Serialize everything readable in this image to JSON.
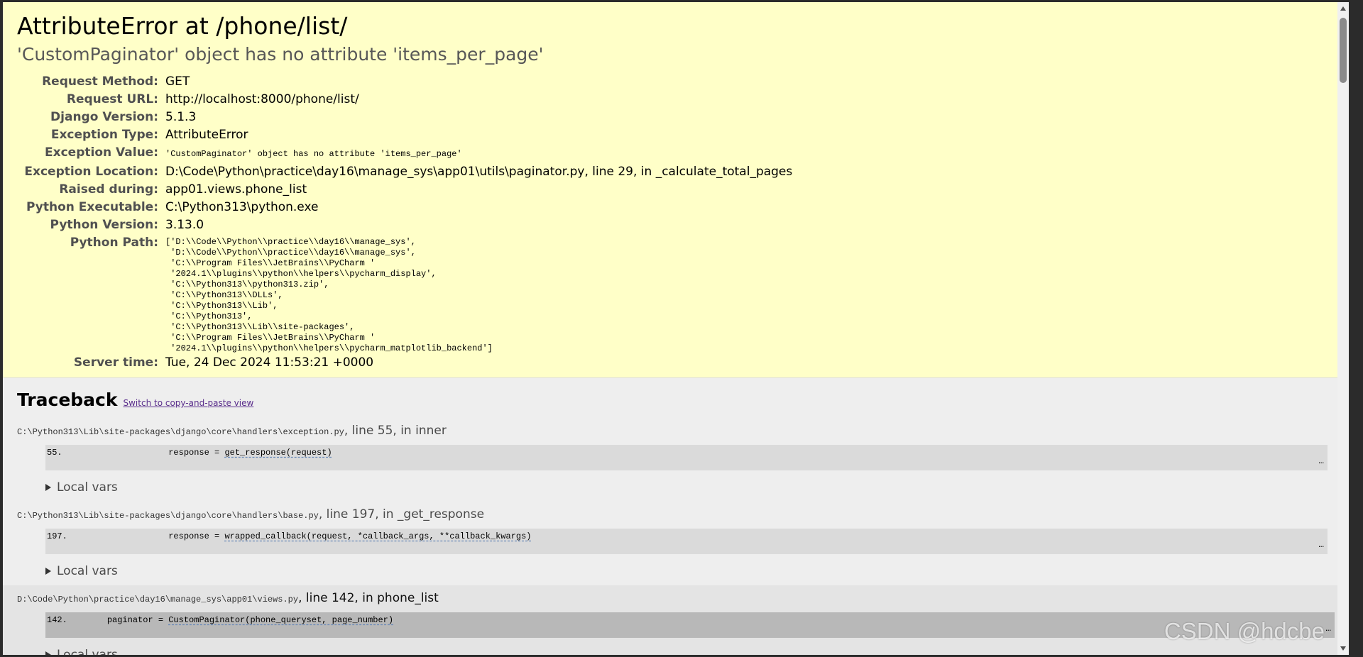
{
  "summary": {
    "title": "AttributeError at /phone/list/",
    "subtitle": "'CustomPaginator' object has no attribute 'items_per_page'",
    "rows": [
      {
        "label": "Request Method:",
        "value": "GET"
      },
      {
        "label": "Request URL:",
        "value": "http://localhost:8000/phone/list/"
      },
      {
        "label": "Django Version:",
        "value": "5.1.3"
      },
      {
        "label": "Exception Type:",
        "value": "AttributeError"
      },
      {
        "label": "Exception Value:",
        "value": "'CustomPaginator' object has no attribute 'items_per_page'"
      },
      {
        "label": "Exception Location:",
        "value": "D:\\Code\\Python\\practice\\day16\\manage_sys\\app01\\utils\\paginator.py, line 29, in _calculate_total_pages"
      },
      {
        "label": "Raised during:",
        "value": "app01.views.phone_list"
      },
      {
        "label": "Python Executable:",
        "value": "C:\\Python313\\python.exe"
      },
      {
        "label": "Python Version:",
        "value": "3.13.0"
      },
      {
        "label": "Python Path:",
        "value": "['D:\\\\Code\\\\Python\\\\practice\\\\day16\\\\manage_sys',\n 'D:\\\\Code\\\\Python\\\\practice\\\\day16\\\\manage_sys',\n 'C:\\\\Program Files\\\\JetBrains\\\\PyCharm '\n '2024.1\\\\plugins\\\\python\\\\helpers\\\\pycharm_display',\n 'C:\\\\Python313\\\\python313.zip',\n 'C:\\\\Python313\\\\DLLs',\n 'C:\\\\Python313\\\\Lib',\n 'C:\\\\Python313',\n 'C:\\\\Python313\\\\Lib\\\\site-packages',\n 'C:\\\\Program Files\\\\JetBrains\\\\PyCharm '\n '2024.1\\\\plugins\\\\python\\\\helpers\\\\pycharm_matplotlib_backend']"
      },
      {
        "label": "Server time:",
        "value": "Tue, 24 Dec 2024 11:53:21 +0000"
      }
    ]
  },
  "traceback": {
    "heading": "Traceback",
    "switch_link": "Switch to copy-and-paste view",
    "local_vars_label": "Local vars",
    "frames": [
      {
        "file": "C:\\Python313\\Lib\\site-packages\\django\\core\\handlers\\exception.py",
        "suffix": ", line 55, in inner",
        "line_no": "55.",
        "indent": "                ",
        "pre": "response = ",
        "call": "get_response(request)"
      },
      {
        "file": "C:\\Python313\\Lib\\site-packages\\django\\core\\handlers\\base.py",
        "suffix": ", line 197, in _get_response",
        "line_no": "197.",
        "indent": "                ",
        "pre": "response = ",
        "call": "wrapped_callback(request, *callback_args, **callback_kwargs)"
      },
      {
        "file": "D:\\Code\\Python\\practice\\day16\\manage_sys\\app01\\views.py",
        "suffix": ", line 142, in phone_list",
        "line_no": "142.",
        "indent": "    ",
        "pre": "paginator = ",
        "call": "CustomPaginator(phone_queryset, page_number)"
      }
    ],
    "ellipsis": "…"
  },
  "watermark": "CSDN @hdcbe"
}
